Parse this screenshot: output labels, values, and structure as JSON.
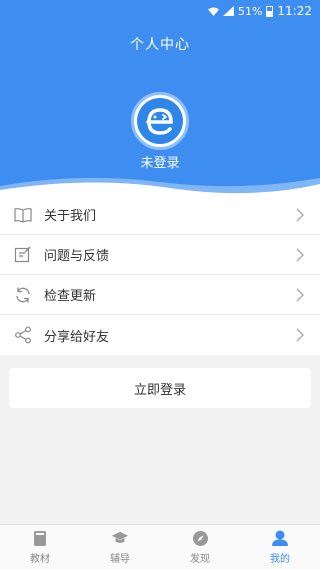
{
  "statusbar": {
    "battery": "51%",
    "time": "11:22"
  },
  "header": {
    "title": "个人中心",
    "login_status": "未登录"
  },
  "menu": [
    {
      "icon": "book-icon",
      "label": "关于我们"
    },
    {
      "icon": "edit-icon",
      "label": "问题与反馈"
    },
    {
      "icon": "refresh-icon",
      "label": "检查更新"
    },
    {
      "icon": "share-icon",
      "label": "分享给好友"
    }
  ],
  "login_button": "立即登录",
  "tabs": [
    {
      "icon": "textbook-icon",
      "label": "教材"
    },
    {
      "icon": "graduation-cap-icon",
      "label": "辅导"
    },
    {
      "icon": "compass-icon",
      "label": "发现"
    },
    {
      "icon": "user-icon",
      "label": "我的"
    }
  ],
  "colors": {
    "primary": "#3d8ef0",
    "background": "#f2f2f2"
  }
}
